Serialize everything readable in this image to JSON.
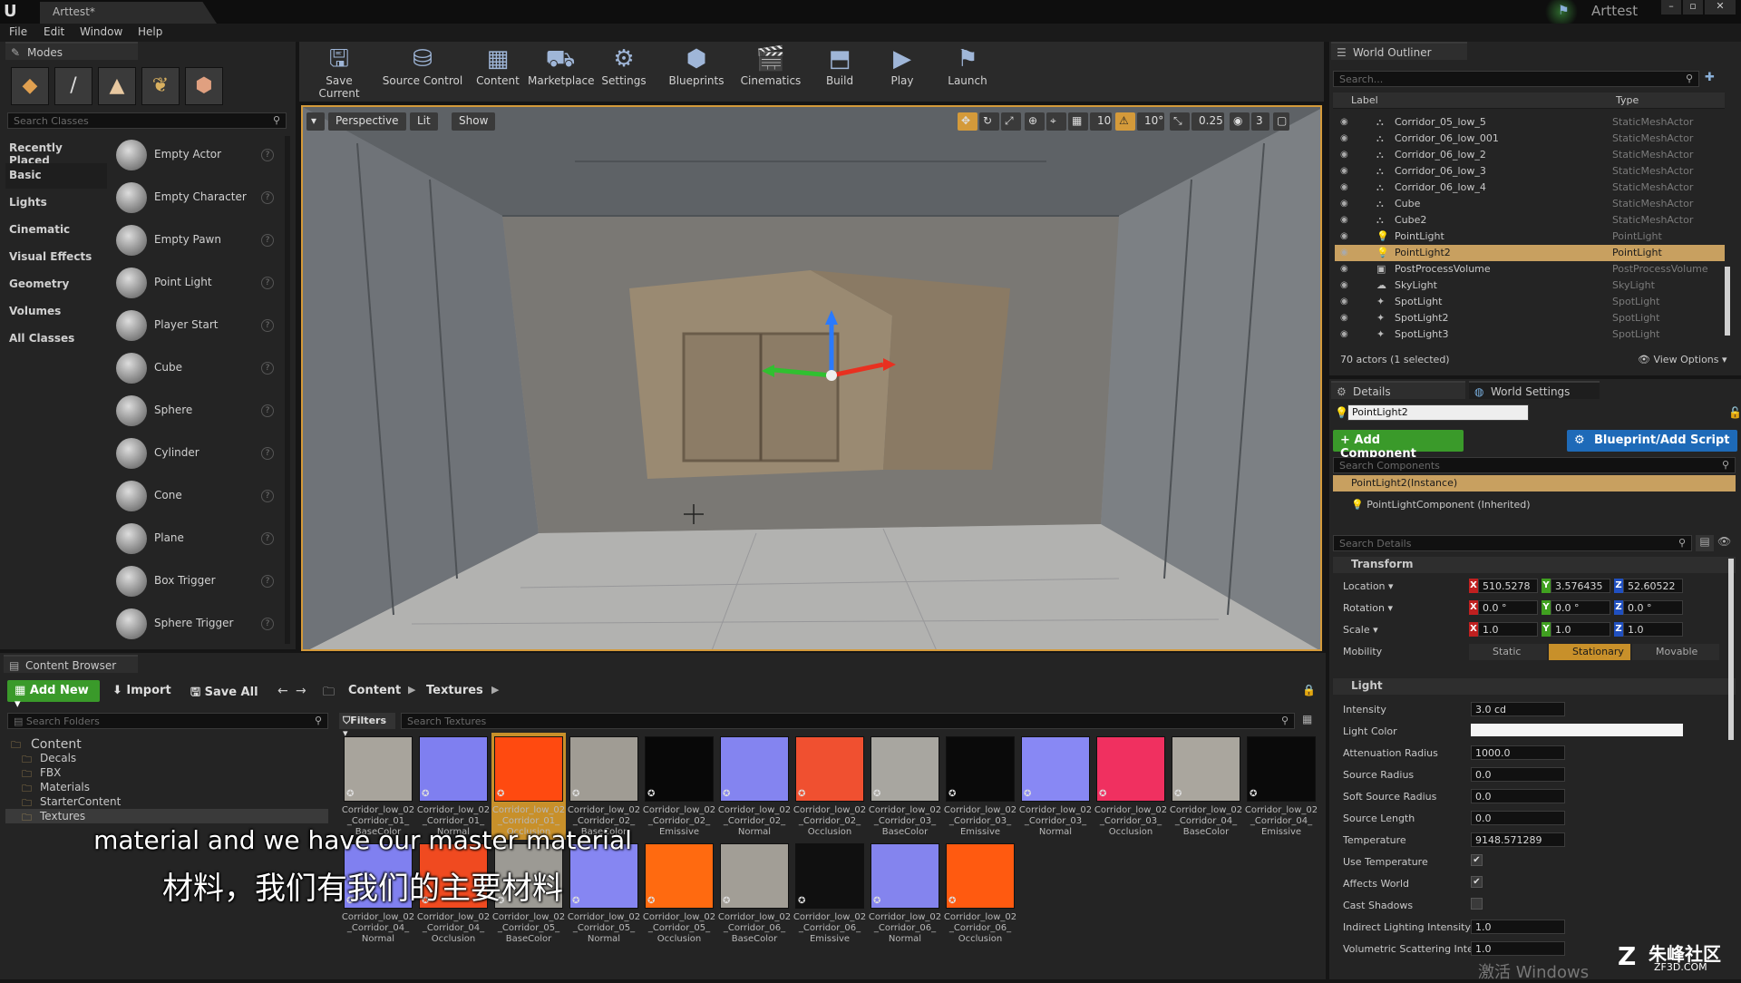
{
  "window": {
    "tab_title": "Arttest*",
    "app_name": "Arttest",
    "logo": "U"
  },
  "menu": [
    "File",
    "Edit",
    "Window",
    "Help"
  ],
  "modes": {
    "tab_label": "Modes",
    "search_placeholder": "Search Classes",
    "categories": [
      "Recently Placed",
      "Basic",
      "Lights",
      "Cinematic",
      "Visual Effects",
      "Geometry",
      "Volumes",
      "All Classes"
    ],
    "selected_category": "Basic",
    "items": [
      "Empty Actor",
      "Empty Character",
      "Empty Pawn",
      "Point Light",
      "Player Start",
      "Cube",
      "Sphere",
      "Cylinder",
      "Cone",
      "Plane",
      "Box Trigger",
      "Sphere Trigger"
    ]
  },
  "toolbar": [
    {
      "label": "Save Current",
      "icon": "save-icon"
    },
    {
      "label": "Source Control",
      "icon": "source-control-icon"
    },
    {
      "label": "Content",
      "icon": "content-icon"
    },
    {
      "label": "Marketplace",
      "icon": "marketplace-icon"
    },
    {
      "label": "Settings",
      "icon": "settings-icon"
    },
    {
      "label": "Blueprints",
      "icon": "blueprints-icon"
    },
    {
      "label": "Cinematics",
      "icon": "cinematics-icon"
    },
    {
      "label": "Build",
      "icon": "build-icon"
    },
    {
      "label": "Play",
      "icon": "play-icon"
    },
    {
      "label": "Launch",
      "icon": "launch-icon"
    }
  ],
  "viewport": {
    "perspective": "Perspective",
    "lit": "Lit",
    "show": "Show",
    "grid_snap": "10",
    "rot_snap": "10°",
    "scale_snap": "0.25",
    "camera_speed": "3"
  },
  "outliner": {
    "tab_label": "World Outliner",
    "search_placeholder": "Search...",
    "col_label": "Label",
    "col_type": "Type",
    "rows": [
      {
        "label": "Corridor_05_low_5",
        "type": "StaticMeshActor"
      },
      {
        "label": "Corridor_06_low_001",
        "type": "StaticMeshActor"
      },
      {
        "label": "Corridor_06_low_2",
        "type": "StaticMeshActor"
      },
      {
        "label": "Corridor_06_low_3",
        "type": "StaticMeshActor"
      },
      {
        "label": "Corridor_06_low_4",
        "type": "StaticMeshActor"
      },
      {
        "label": "Cube",
        "type": "StaticMeshActor"
      },
      {
        "label": "Cube2",
        "type": "StaticMeshActor"
      },
      {
        "label": "PointLight",
        "type": "PointLight"
      },
      {
        "label": "PointLight2",
        "type": "PointLight"
      },
      {
        "label": "PostProcessVolume",
        "type": "PostProcessVolume"
      },
      {
        "label": "SkyLight",
        "type": "SkyLight"
      },
      {
        "label": "SpotLight",
        "type": "SpotLight"
      },
      {
        "label": "SpotLight2",
        "type": "SpotLight"
      },
      {
        "label": "SpotLight3",
        "type": "SpotLight"
      }
    ],
    "selected_index": 8,
    "status": "70 actors (1 selected)",
    "view_options": "View Options"
  },
  "details": {
    "tab_details": "Details",
    "tab_world_settings": "World Settings",
    "name_value": "PointLight2",
    "add_component": "+ Add Component",
    "blueprint_script": "Blueprint/Add Script",
    "search_components": "Search Components",
    "instance": "PointLight2(Instance)",
    "component": "PointLightComponent (Inherited)",
    "search_details": "Search Details",
    "transform_header": "Transform",
    "location_label": "Location",
    "location": [
      "510.5278",
      "3.576435",
      "52.60522"
    ],
    "rotation_label": "Rotation",
    "rotation": [
      "0.0 °",
      "0.0 °",
      "0.0 °"
    ],
    "scale_label": "Scale",
    "scale": [
      "1.0",
      "1.0",
      "1.0"
    ],
    "mobility_label": "Mobility",
    "mobility_options": [
      "Static",
      "Stationary",
      "Movable"
    ],
    "mobility_selected": "Stationary",
    "light_header": "Light",
    "light_props": [
      {
        "label": "Intensity",
        "value": "3.0 cd"
      },
      {
        "label": "Light Color",
        "value": ""
      },
      {
        "label": "Attenuation Radius",
        "value": "1000.0"
      },
      {
        "label": "Source Radius",
        "value": "0.0"
      },
      {
        "label": "Soft Source Radius",
        "value": "0.0"
      },
      {
        "label": "Source Length",
        "value": "0.0"
      },
      {
        "label": "Temperature",
        "value": "9148.571289"
      }
    ],
    "checkbox_props": [
      {
        "label": "Use Temperature",
        "checked": true
      },
      {
        "label": "Affects World",
        "checked": true
      },
      {
        "label": "Cast Shadows",
        "checked": false
      }
    ],
    "more_props": [
      {
        "label": "Indirect Lighting Intensity",
        "value": "1.0"
      },
      {
        "label": "Volumetric Scattering Inter",
        "value": "1.0"
      }
    ]
  },
  "content_browser": {
    "tab_label": "Content Browser",
    "add_new": "Add New",
    "import": "Import",
    "save_all": "Save All",
    "breadcrumb": [
      "Content",
      "Textures"
    ],
    "search_folders": "Search Folders",
    "filters": "Filters",
    "search_textures": "Search Textures",
    "folders": [
      {
        "name": "Content",
        "level": 0
      },
      {
        "name": "Decals",
        "level": 1
      },
      {
        "name": "FBX",
        "level": 1
      },
      {
        "name": "Materials",
        "level": 1
      },
      {
        "name": "StarterContent",
        "level": 1
      },
      {
        "name": "Textures",
        "level": 1
      }
    ],
    "assets_row1": [
      {
        "l1": "Corridor_low_02",
        "l2": "_Corridor_01_",
        "l3": "BaseColor",
        "color": "#a8a49c"
      },
      {
        "l1": "Corridor_low_02",
        "l2": "_Corridor_01_",
        "l3": "Normal",
        "color": "#7f7ff0"
      },
      {
        "l1": "Corridor_low_02",
        "l2": "_Corridor_01_",
        "l3": "Occlusion",
        "color": "#ff4a10"
      },
      {
        "l1": "Corridor_low_02",
        "l2": "_Corridor_02_",
        "l3": "BaseColor",
        "color": "#a09c94"
      },
      {
        "l1": "Corridor_low_02",
        "l2": "_Corridor_02_",
        "l3": "Emissive",
        "color": "#080808"
      },
      {
        "l1": "Corridor_low_02",
        "l2": "_Corridor_02_",
        "l3": "Normal",
        "color": "#8484f0"
      },
      {
        "l1": "Corridor_low_02",
        "l2": "_Corridor_02_",
        "l3": "Occlusion",
        "color": "#f05030"
      },
      {
        "l1": "Corridor_low_02",
        "l2": "_Corridor_03_",
        "l3": "BaseColor",
        "color": "#a8a6a0"
      },
      {
        "l1": "Corridor_low_02",
        "l2": "_Corridor_03_",
        "l3": "Emissive",
        "color": "#0a0a0a"
      },
      {
        "l1": "Corridor_low_02",
        "l2": "_Corridor_03_",
        "l3": "Normal",
        "color": "#8888f4"
      },
      {
        "l1": "Corridor_low_02",
        "l2": "_Corridor_03_",
        "l3": "Occlusion",
        "color": "#f03060"
      },
      {
        "l1": "Corridor_low_02",
        "l2": "_Corridor_04_",
        "l3": "BaseColor",
        "color": "#aaa69e"
      },
      {
        "l1": "Corridor_low_02",
        "l2": "_Corridor_04_",
        "l3": "Emissive",
        "color": "#0a0a0a"
      }
    ],
    "assets_row2": [
      {
        "l1": "Corridor_low_02",
        "l2": "_Corridor_04_",
        "l3": "Normal",
        "color": "#8080f0"
      },
      {
        "l1": "Corridor_low_02",
        "l2": "_Corridor_04_",
        "l3": "Occlusion",
        "color": "#f04a20"
      },
      {
        "l1": "Corridor_low_02",
        "l2": "_Corridor_05_",
        "l3": "BaseColor",
        "color": "#9c9a94"
      },
      {
        "l1": "Corridor_low_02",
        "l2": "_Corridor_05_",
        "l3": "Normal",
        "color": "#8686f2"
      },
      {
        "l1": "Corridor_low_02",
        "l2": "_Corridor_05_",
        "l3": "Occlusion",
        "color": "#ff6a10"
      },
      {
        "l1": "Corridor_low_02",
        "l2": "_Corridor_06_",
        "l3": "BaseColor",
        "color": "#a29e96"
      },
      {
        "l1": "Corridor_low_02",
        "l2": "_Corridor_06_",
        "l3": "Emissive",
        "color": "#101010"
      },
      {
        "l1": "Corridor_low_02",
        "l2": "_Corridor_06_",
        "l3": "Normal",
        "color": "#8484ee"
      },
      {
        "l1": "Corridor_low_02",
        "l2": "_Corridor_06_",
        "l3": "Occlusion",
        "color": "#ff5a10"
      }
    ]
  },
  "subtitles": {
    "en": "material and we have our master material",
    "zh": "材料，我们有我们的主要材料"
  },
  "watermark": {
    "windows": "激活 Windows",
    "brand": "朱峰社区",
    "brand_url": "ZF3D.COM"
  },
  "colors": {
    "accent_orange": "#d49a3a",
    "add_green": "#3a9a2a",
    "blueprint_blue": "#1e6ab8",
    "selection": "#c8a060"
  }
}
